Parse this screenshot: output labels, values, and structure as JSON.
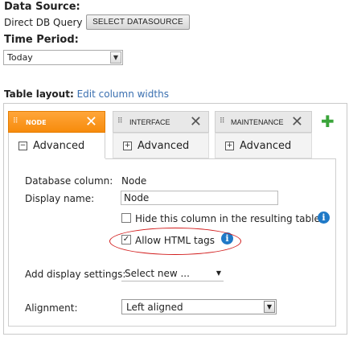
{
  "data_source": {
    "label": "Data Source:",
    "value": "Direct DB Query",
    "button_label": "SELECT DATASOURCE"
  },
  "time_period": {
    "label": "Time Period:",
    "selected": "Today"
  },
  "table_layout": {
    "label": "Table layout:",
    "link": "Edit column widths"
  },
  "tabs": [
    {
      "name": "NODE",
      "subtab": "Advanced",
      "active": true
    },
    {
      "name": "INTERFACE",
      "subtab": "Advanced",
      "active": false
    },
    {
      "name": "MAINTENANCE",
      "subtab": "Advanced",
      "active": false
    }
  ],
  "column_settings": {
    "database_column_label": "Database column:",
    "database_column_value": "Node",
    "display_name_label": "Display name:",
    "display_name_value": "Node",
    "hide_column_label": "Hide this column in the resulting table",
    "hide_column_checked": false,
    "allow_html_label": "Allow HTML tags",
    "allow_html_checked": true,
    "add_display_label": "Add display settings:",
    "add_display_value": "Select new ...",
    "alignment_label": "Alignment:",
    "alignment_value": "Left aligned"
  },
  "icons": {
    "close": "close-icon",
    "add": "add-icon",
    "info": "info-icon",
    "grip": "drag-grip-icon"
  },
  "colors": {
    "active_tab": "#f78b0c",
    "link": "#3a6fb0",
    "info": "#1f79c7",
    "annotation": "#d21d1d",
    "add": "#3aa43a"
  }
}
